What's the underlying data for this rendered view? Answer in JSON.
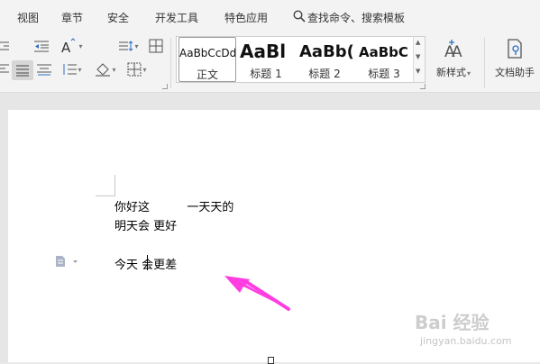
{
  "menu": {
    "items": [
      "视图",
      "章节",
      "安全",
      "开发工具",
      "特色应用"
    ],
    "search_label": "查找命令、搜索模板"
  },
  "ribbon": {
    "styles": [
      {
        "sample": "AaBbCcDd",
        "caption": "正文",
        "selected": true
      },
      {
        "sample": "AaBl",
        "caption": "标题 1",
        "selected": false
      },
      {
        "sample": "AaBb(",
        "caption": "标题 2",
        "selected": false
      },
      {
        "sample": "AaBbC",
        "caption": "标题 3",
        "selected": false
      }
    ],
    "new_style_label": "新样式",
    "doc_assistant_label": "文档助手"
  },
  "document": {
    "lines": [
      "你好这          一天天的",
      "明天会 更好",
      "今天 会更差"
    ]
  },
  "watermark": {
    "logo": "Bai 经验",
    "url": "jingyan.baidu.com"
  },
  "colors": {
    "arrow": "#ff3de0",
    "menu_bg": "#f3f3f3",
    "page_bg": "#ffffff"
  }
}
